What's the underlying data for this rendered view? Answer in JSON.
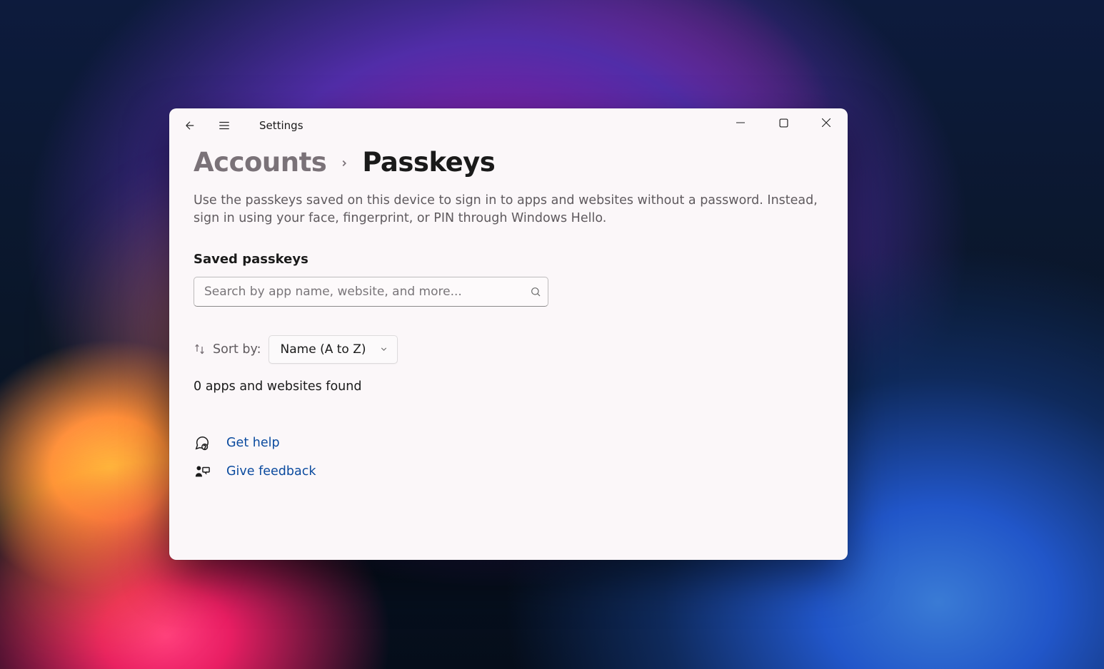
{
  "titlebar": {
    "app_name": "Settings"
  },
  "breadcrumb": {
    "parent": "Accounts",
    "current": "Passkeys"
  },
  "description": "Use the passkeys saved on this device to sign in to apps and websites without a password. Instead, sign in using your face, fingerprint, or PIN through Windows Hello.",
  "section_title": "Saved passkeys",
  "search": {
    "placeholder": "Search by app name, website, and more..."
  },
  "sort": {
    "label": "Sort by:",
    "selected": "Name (A to Z)"
  },
  "results_count": "0 apps and websites found",
  "links": {
    "help": "Get help",
    "feedback": "Give feedback"
  }
}
